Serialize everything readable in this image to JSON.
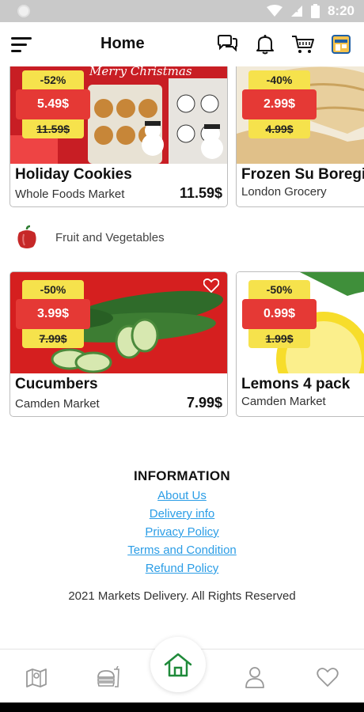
{
  "status_bar": {
    "time": "8:20"
  },
  "app_bar": {
    "title": "Home"
  },
  "top_products": [
    {
      "name": "Holiday Cookies",
      "store": "Whole Foods Market",
      "price": "11.59$",
      "discount": "-52%",
      "sale_price": "5.49$",
      "old_price": "11.59$",
      "image_text": "Merry Christmas"
    },
    {
      "name": "Frozen Su Boregi",
      "store": "London Grocery",
      "price": "",
      "discount": "-40%",
      "sale_price": "2.99$",
      "old_price": "4.99$"
    }
  ],
  "category": {
    "label": "Fruit and Vegetables",
    "icon": "pepper-icon"
  },
  "category_products": [
    {
      "name": "Cucumbers",
      "store": "Camden Market",
      "price": "7.99$",
      "discount": "-50%",
      "sale_price": "3.99$",
      "old_price": "7.99$"
    },
    {
      "name": "Lemons 4 pack",
      "store": "Camden Market",
      "price": "",
      "discount": "-50%",
      "sale_price": "0.99$",
      "old_price": "1.99$"
    }
  ],
  "information": {
    "title": "INFORMATION",
    "links": [
      "About Us",
      "Delivery info",
      "Privacy Policy",
      "Terms and Condition",
      "Refund Policy"
    ],
    "copyright": "2021 Markets Delivery. All Rights Reserved"
  },
  "bottom_nav": {
    "items": [
      "map-icon",
      "food-icon",
      "home-icon",
      "user-icon",
      "heart-icon"
    ]
  },
  "colors": {
    "accent_green": "#1f8a3a",
    "sale_red": "#e53935",
    "badge_yellow": "#f6e24c",
    "link_blue": "#2b9de6"
  }
}
